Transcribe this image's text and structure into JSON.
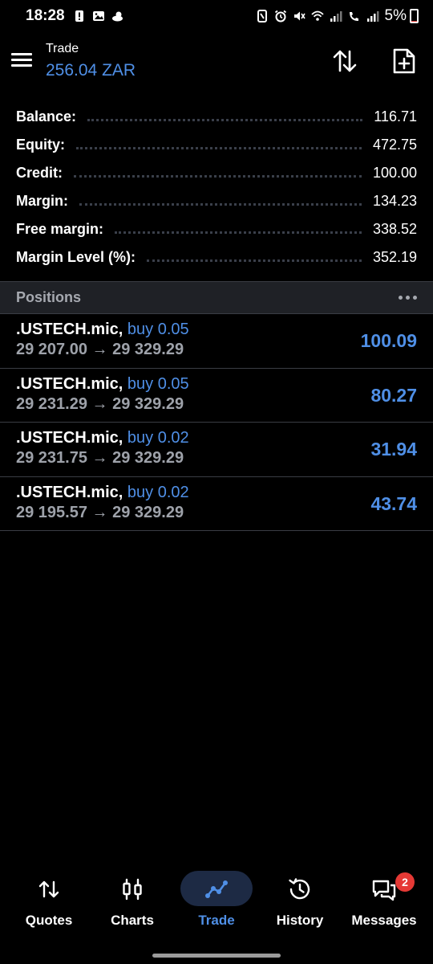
{
  "status_bar": {
    "time": "18:28",
    "battery_percent": "5%",
    "battery_level": 0.05,
    "battery_color": "#e53935"
  },
  "header": {
    "title": "Trade",
    "subtitle": "256.04 ZAR",
    "icons": [
      "menu-icon",
      "sort-icon",
      "new-order-icon"
    ]
  },
  "summary": [
    {
      "label": "Balance:",
      "value": "116.71"
    },
    {
      "label": "Equity:",
      "value": "472.75"
    },
    {
      "label": "Credit:",
      "value": "100.00"
    },
    {
      "label": "Margin:",
      "value": "134.23"
    },
    {
      "label": "Free margin:",
      "value": "338.52"
    },
    {
      "label": "Margin Level (%):",
      "value": "352.19"
    }
  ],
  "positions_header": {
    "title": "Positions"
  },
  "positions": [
    {
      "symbol": ".USTECH.mic,",
      "type": "buy 0.05",
      "prices": "29 207.00 → 29 329.29",
      "profit": "100.09"
    },
    {
      "symbol": ".USTECH.mic,",
      "type": "buy 0.05",
      "prices": "29 231.29 → 29 329.29",
      "profit": "80.27"
    },
    {
      "symbol": ".USTECH.mic,",
      "type": "buy 0.02",
      "prices": "29 231.75 → 29 329.29",
      "profit": "31.94"
    },
    {
      "symbol": ".USTECH.mic,",
      "type": "buy 0.02",
      "prices": "29 195.57 → 29 329.29",
      "profit": "43.74"
    }
  ],
  "bottom_nav": [
    {
      "label": "Quotes",
      "icon": "quotes-icon"
    },
    {
      "label": "Charts",
      "icon": "charts-icon"
    },
    {
      "label": "Trade",
      "icon": "trade-icon",
      "active": true
    },
    {
      "label": "History",
      "icon": "history-icon"
    },
    {
      "label": "Messages",
      "icon": "messages-icon",
      "badge": "2"
    }
  ],
  "colors": {
    "accent": "#4f8fe6",
    "background": "#000000",
    "section_header": "#1f2126",
    "active_pill": "#1d2a44",
    "badge": "#e53935"
  }
}
